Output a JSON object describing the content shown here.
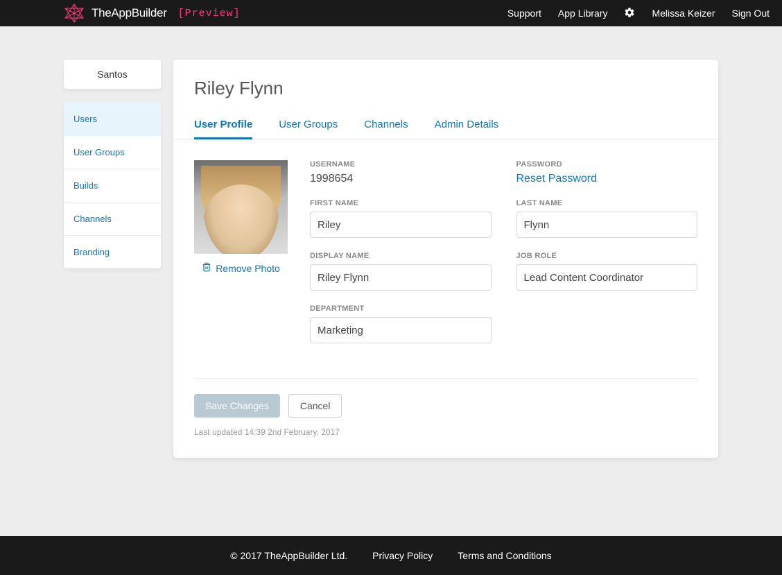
{
  "header": {
    "brand": "TheAppBuilder",
    "preview_text": "[Preview]",
    "nav": {
      "support": "Support",
      "app_library": "App Library",
      "gear_icon": "gear-icon",
      "user_name": "Melissa Keizer",
      "sign_out": "Sign Out"
    }
  },
  "sidebar": {
    "company": "Santos",
    "items": [
      "Users",
      "User Groups",
      "Builds",
      "Channels",
      "Branding"
    ],
    "active_index": 0
  },
  "main": {
    "title": "Riley Flynn",
    "tabs": [
      "User Profile",
      "User Groups",
      "Channels",
      "Admin Details"
    ],
    "active_tab_index": 0,
    "remove_photo_label": "Remove Photo",
    "fields": {
      "username_label": "USERNAME",
      "username_value": "1998654",
      "password_label": "PASSWORD",
      "reset_password": "Reset Password",
      "first_name_label": "FIRST NAME",
      "first_name_value": "Riley",
      "last_name_label": "LAST NAME",
      "last_name_value": "Flynn",
      "display_name_label": "DISPLAY NAME",
      "display_name_value": "Riley Flynn",
      "job_role_label": "JOB ROLE",
      "job_role_value": "Lead Content Coordinator",
      "department_label": "DEPARTMENT",
      "department_value": "Marketing"
    },
    "save_label": "Save Changes",
    "cancel_label": "Cancel",
    "last_updated": "Last updated 14:39 2nd February, 2017"
  },
  "footer": {
    "copyright": "© 2017 TheAppBuilder Ltd.",
    "privacy": "Privacy Policy",
    "terms": "Terms and Conditions"
  }
}
